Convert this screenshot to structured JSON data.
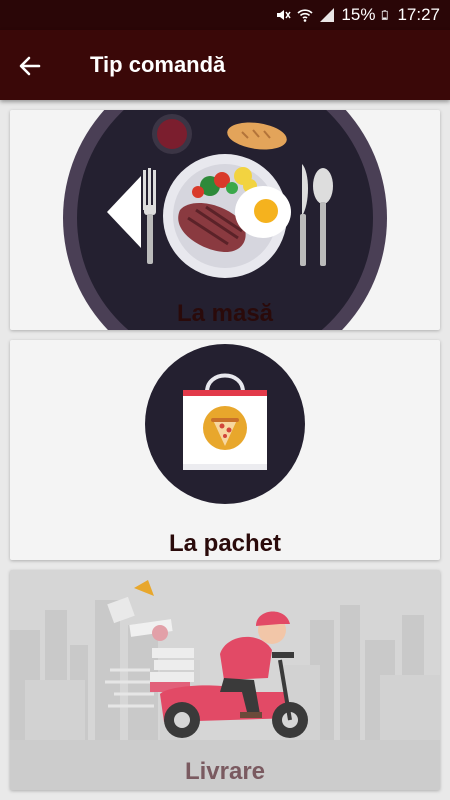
{
  "status_bar": {
    "battery_percent": "15%",
    "time": "17:27",
    "icons": [
      "mute-icon",
      "wifi-icon",
      "signal-icon",
      "battery-icon"
    ]
  },
  "header": {
    "title": "Tip comandă",
    "back_icon": "arrow-left-icon"
  },
  "options": [
    {
      "label": "La masă",
      "icon": "dine-in-plate-illustration"
    },
    {
      "label": "La pachet",
      "icon": "takeaway-bag-illustration"
    },
    {
      "label": "Livrare",
      "icon": "delivery-scooter-illustration"
    }
  ],
  "colors": {
    "status_bar": "#2a0607",
    "app_bar": "#3a0808",
    "card_background": "#f4f4f4",
    "label_text": "#2a0a0a",
    "delivery_label_text": "#7a5a60"
  }
}
